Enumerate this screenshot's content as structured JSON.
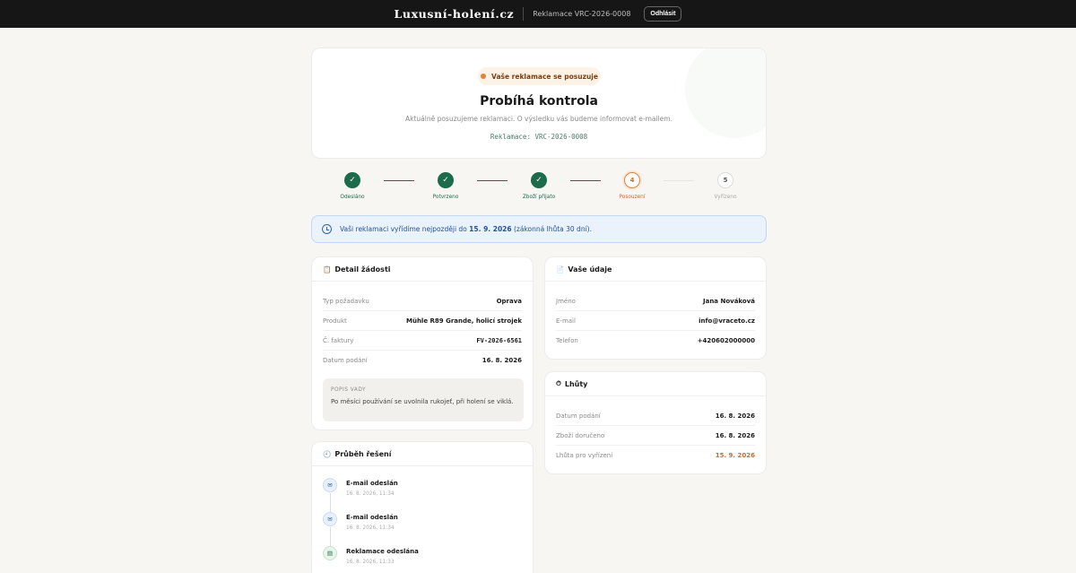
{
  "header": {
    "brand": "Luxusní-holení.cz",
    "reference": "Reklamace VRC-2026-0008",
    "logout_label": "Odhlásit"
  },
  "status": {
    "badge": "Vaše reklamace se posuzuje",
    "title": "Probíhá kontrola",
    "subtitle": "Aktuálně posuzujeme reklamaci. O výsledku vás budeme informovat e-mailem.",
    "code": "Reklamace: VRC-2026-0008"
  },
  "steps": [
    {
      "marker": "✓",
      "label": "Odesláno",
      "state": "done"
    },
    {
      "marker": "✓",
      "label": "Potvrzeno",
      "state": "done"
    },
    {
      "marker": "✓",
      "label": "Zboží přijato",
      "state": "done"
    },
    {
      "marker": "4",
      "label": "Posouzení",
      "state": "active"
    },
    {
      "marker": "5",
      "label": "Vyřízeno",
      "state": "todo"
    }
  ],
  "notice": {
    "prefix": "Vaši reklamaci vyřídíme nejpozději do ",
    "date": "15. 9. 2026",
    "suffix": " (zákonná lhůta 30 dní)."
  },
  "detail": {
    "title": "Detail žádosti",
    "icon": "clipboard-icon",
    "rows": [
      {
        "label": "Typ požadavku",
        "value": "Oprava"
      },
      {
        "label": "Produkt",
        "value": "Mühle R89 Grande, holicí strojek"
      },
      {
        "label": "Č. faktury",
        "value": "FV-2026-6561"
      },
      {
        "label": "Datum podání",
        "value": "16. 8. 2026"
      }
    ],
    "defect_title": "POPIS VADY",
    "defect_text": "Po měsíci používání se uvolnila rukojeť, při holení se viklá."
  },
  "customer": {
    "title": "Vaše údaje",
    "icon": "document-icon",
    "rows": [
      {
        "label": "Jméno",
        "value": "Jana Nováková"
      },
      {
        "label": "E-mail",
        "value": "info@vraceto.cz"
      },
      {
        "label": "Telefon",
        "value": "+420602000000"
      }
    ]
  },
  "deadlines": {
    "title": "Lhůty",
    "icon": "stopwatch-icon",
    "rows": [
      {
        "label": "Datum podání",
        "value": "16. 8. 2026"
      },
      {
        "label": "Zboží doručeno",
        "value": "16. 8. 2026"
      },
      {
        "label": "Lhůta pro vyřízení",
        "value": "15. 9. 2026"
      }
    ]
  },
  "progress": {
    "title": "Průběh řešení",
    "icon": "clock-icon",
    "events": [
      {
        "title": "E-mail odeslán",
        "time": "16. 8. 2026, 11:34",
        "icon": "mail-icon"
      },
      {
        "title": "E-mail odeslán",
        "time": "16. 8. 2026, 11:34",
        "icon": "mail-icon"
      },
      {
        "title": "Reklamace odeslána",
        "time": "16. 8. 2026, 11:33",
        "icon": "clipboard-icon"
      }
    ]
  },
  "colors": {
    "accent_green": "#1c6b4a",
    "accent_orange": "#d26a1f",
    "info_blue": "#24529a"
  }
}
